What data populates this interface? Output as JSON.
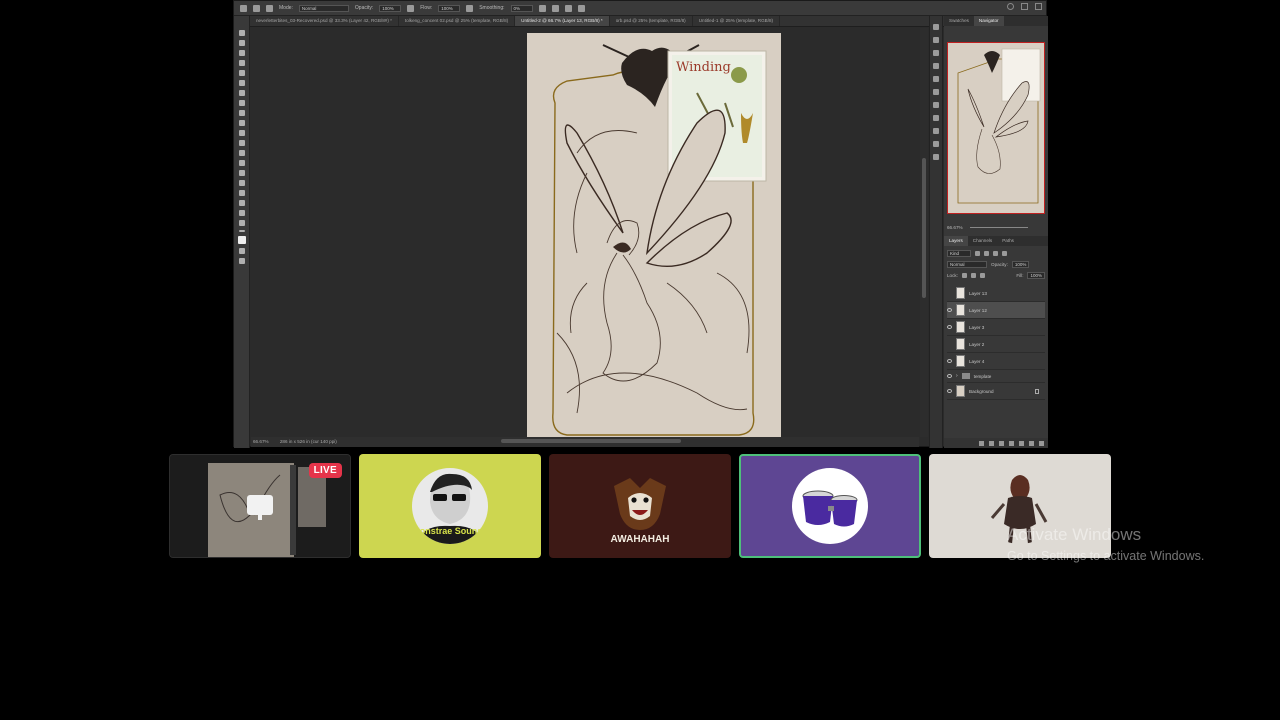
{
  "photoshop": {
    "options_bar": {
      "mode_label": "Mode:",
      "mode_value": "Normal",
      "opacity_label": "Opacity:",
      "opacity_value": "100%",
      "flow_label": "Flow:",
      "flow_value": "100%",
      "smoothing_label": "Smoothing:",
      "smoothing_value": "0%"
    },
    "document_tabs": [
      {
        "label": "neverletterbites_03-Recovered.psd @ 33.3% (Layer 42, RGB/8#) *",
        "active": false
      },
      {
        "label": "tolkeng_concent 02.psd @ 25% (template, RGB/8)",
        "active": false
      },
      {
        "label": "Untitled-2 @ 66.7% (Layer 13, RGB/8) *",
        "active": true
      },
      {
        "label": "orb.psd @ 25% (template, RGB/8)",
        "active": false
      },
      {
        "label": "Untitled-1 @ 25% (template, RGB/8)",
        "active": false
      }
    ],
    "status": {
      "zoom": "66.67%",
      "doc_size": "286 in x 526 in (cur 140 ppi)"
    },
    "panels": {
      "top_tabs": [
        "Swatches",
        "Navigator"
      ],
      "active_top_tab": "Navigator",
      "nav_zoom": "66.67%",
      "layer_tabs": [
        "Layers",
        "Channels",
        "Paths"
      ],
      "kind_label": "Kind",
      "blend_mode": "Normal",
      "opacity_label": "Opacity:",
      "opacity_value": "100%",
      "lock_label": "Lock:",
      "fill_label": "Fill:",
      "fill_value": "100%",
      "layers": [
        {
          "name": "Layer 13",
          "visible": false,
          "selected": false,
          "type": "layer"
        },
        {
          "name": "Layer 12",
          "visible": true,
          "selected": true,
          "type": "layer"
        },
        {
          "name": "Layer 3",
          "visible": true,
          "selected": false,
          "type": "layer"
        },
        {
          "name": "Layer 2",
          "visible": false,
          "selected": false,
          "type": "layer"
        },
        {
          "name": "Layer 4",
          "visible": true,
          "selected": false,
          "type": "layer"
        },
        {
          "name": "template",
          "visible": true,
          "selected": false,
          "type": "group"
        },
        {
          "name": "Background",
          "visible": true,
          "selected": false,
          "type": "background"
        }
      ]
    },
    "reference_card_title": "Winding"
  },
  "call": {
    "live_badge": "LIVE",
    "tiles": [
      {
        "name": "screen-share",
        "bg": "#1c1c1c"
      },
      {
        "name": "participant-sunglasses",
        "bg": "#cdd650",
        "avatar_text": "Monstrae Sounds"
      },
      {
        "name": "participant-dog",
        "bg": "#3d1915",
        "avatar_text": "AWAHAHAH"
      },
      {
        "name": "participant-drums",
        "bg": "#5e4693",
        "speaking": true
      },
      {
        "name": "participant-warrior",
        "bg": "#dedad4"
      }
    ]
  },
  "watermark": {
    "title": "Activate Windows",
    "subtitle": "Go to Settings to activate Windows."
  }
}
